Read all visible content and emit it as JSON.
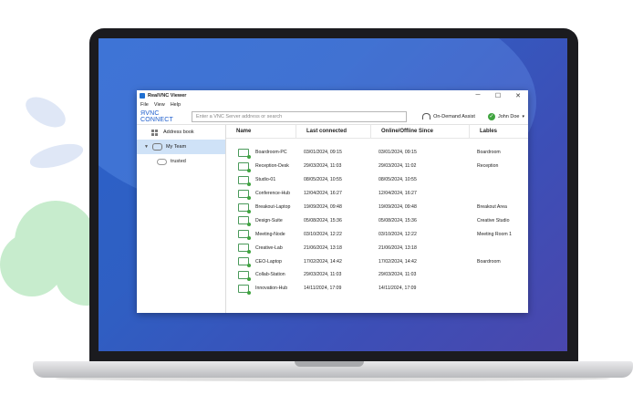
{
  "window": {
    "title": "RealVNC Viewer",
    "menu": [
      "File",
      "View",
      "Help"
    ],
    "logo": "ЯVNC CONNECT",
    "search_placeholder": "Enter a VNC Server address or search",
    "on_demand": "On-Demand Assist",
    "user_name": "John Doe",
    "win_min": "─",
    "win_max": "☐",
    "win_close": "✕"
  },
  "sidebar": {
    "address_book": "Address book",
    "my_team": "My Team",
    "trusted": "trusted"
  },
  "table": {
    "headers": [
      "Name",
      "Last connected",
      "Online/Offline Since",
      "Lables"
    ],
    "rows": [
      {
        "name": "Boardroom-PC",
        "last": "03/01/2024, 09:15",
        "since": "03/01/2024, 09:15",
        "label": "Boardroom"
      },
      {
        "name": "Reception-Desk",
        "last": "29/03/2024, 11:03",
        "since": "29/03/2024, 11:02",
        "label": "Reception"
      },
      {
        "name": "Studio-01",
        "last": "08/05/2024, 10:55",
        "since": "08/05/2024, 10:55",
        "label": ""
      },
      {
        "name": "Conference-Hub",
        "last": "12/04/2024, 16:27",
        "since": "12/04/2024, 16:27",
        "label": ""
      },
      {
        "name": "Breakout-Laptop",
        "last": "19/09/2024, 09:48",
        "since": "19/09/2024, 09:48",
        "label": "Breakout Area"
      },
      {
        "name": "Design-Suite",
        "last": "05/08/2024, 15:36",
        "since": "05/08/2024, 15:36",
        "label": "Creative Studio"
      },
      {
        "name": "Meeting-Node",
        "last": "03/10/2024, 12:22",
        "since": "03/10/2024, 12:22",
        "label": "Meeting Room 1"
      },
      {
        "name": "Creative-Lab",
        "last": "21/06/2024, 13:18",
        "since": "21/06/2024, 13:18",
        "label": ""
      },
      {
        "name": "CEO-Laptop",
        "last": "17/02/2024, 14:42",
        "since": "17/02/2024, 14:42",
        "label": "Boardroom"
      },
      {
        "name": "Collab-Station",
        "last": "29/03/2024, 11:03",
        "since": "29/03/2024, 11:03",
        "label": ""
      },
      {
        "name": "Innovation-Hub",
        "last": "14/11/2024, 17:09",
        "since": "14/11/2024, 17:09",
        "label": ""
      }
    ]
  },
  "colors": {
    "accent": "#1b5ccc",
    "online": "#3fa43f",
    "selection": "#cfe2f7"
  }
}
